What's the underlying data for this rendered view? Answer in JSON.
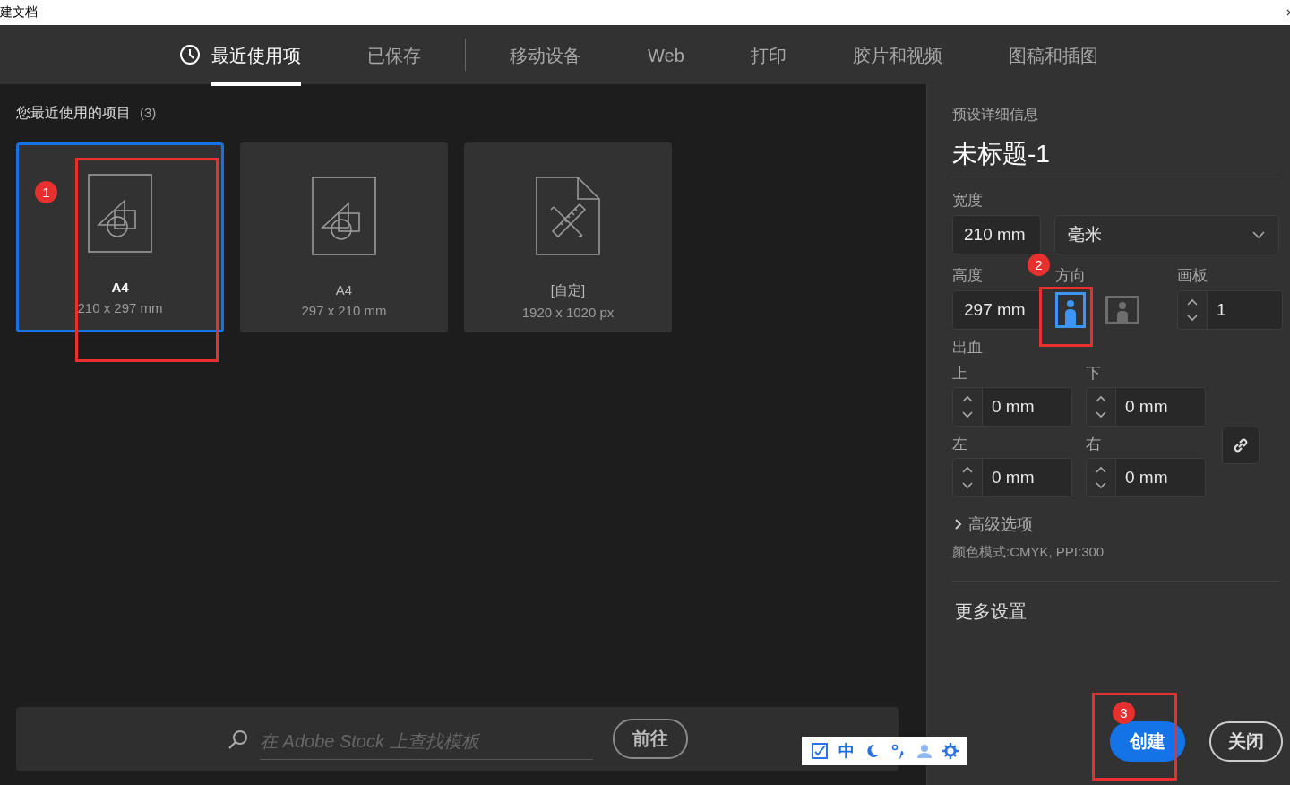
{
  "window": {
    "title": "建文档"
  },
  "tabs": [
    {
      "label": "最近使用项",
      "selected": true,
      "kind": "recent"
    },
    {
      "label": "已保存",
      "selected": false,
      "kind": "plain",
      "separator_after": true
    },
    {
      "label": "移动设备",
      "selected": false,
      "kind": "plain"
    },
    {
      "label": "Web",
      "selected": false,
      "kind": "plain"
    },
    {
      "label": "打印",
      "selected": false,
      "kind": "plain"
    },
    {
      "label": "胶片和视频",
      "selected": false,
      "kind": "plain"
    },
    {
      "label": "图稿和插图",
      "selected": false,
      "kind": "plain"
    }
  ],
  "recent": {
    "heading": "您最近使用的项目",
    "count": "(3)",
    "items": [
      {
        "name": "A4",
        "size": "210 x 297 mm",
        "selected": true,
        "kind": "preset"
      },
      {
        "name": "A4",
        "size": "297 x 210 mm",
        "selected": false,
        "kind": "preset"
      },
      {
        "name": "[自定]",
        "size": "1920 x 1020 px",
        "selected": false,
        "kind": "custom"
      }
    ]
  },
  "details": {
    "heading": "预设详细信息",
    "doc_name": "未标题-1",
    "width_label": "宽度",
    "width": "210 mm",
    "unit": "毫米",
    "height_label": "高度",
    "height": "297 mm",
    "orientation_label": "方向",
    "orientations": [
      {
        "kind": "portrait",
        "selected": true
      },
      {
        "kind": "landscape",
        "selected": false
      }
    ],
    "artboards_label": "画板",
    "artboards": "1",
    "bleed_label": "出血",
    "bleed": [
      {
        "label": "上",
        "value": "0 mm"
      },
      {
        "label": "下",
        "value": "0 mm"
      },
      {
        "label": "左",
        "value": "0 mm"
      },
      {
        "label": "右",
        "value": "0 mm"
      }
    ],
    "advanced": "高级选项",
    "color_mode": "颜色模式:CMYK, PPI:300",
    "more": "更多设置"
  },
  "footer": {
    "search_placeholder": "在 Adobe Stock 上查找模板",
    "go": "前往",
    "create": "创建",
    "close": "关闭"
  },
  "ime_toolbar": {
    "label": "中"
  },
  "annotations": [
    {
      "number": "1"
    },
    {
      "number": "2"
    },
    {
      "number": "3"
    }
  ]
}
